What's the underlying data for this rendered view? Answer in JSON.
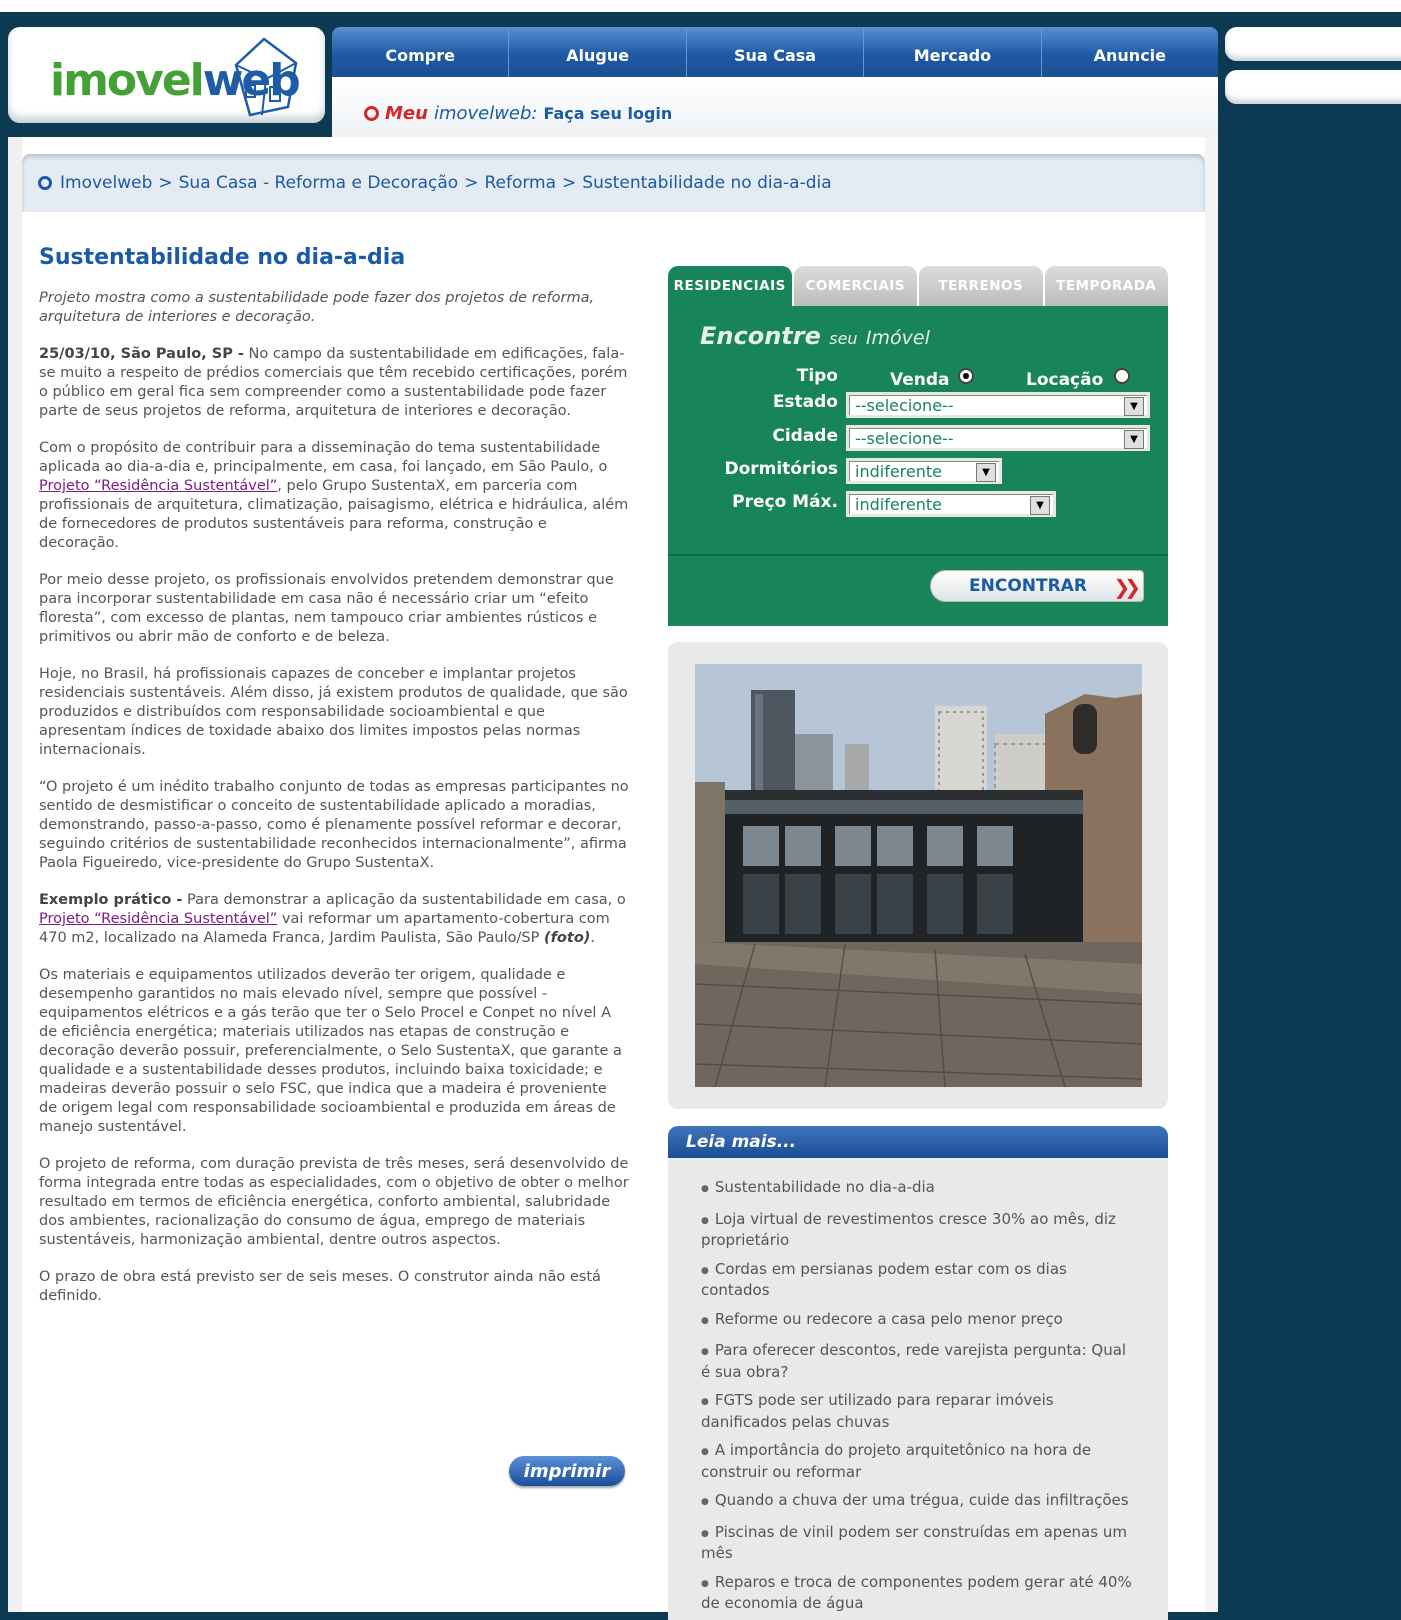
{
  "header": {
    "logo_green": "imovel",
    "logo_blue": "web",
    "nav": [
      "Compre",
      "Alugue",
      "Sua Casa",
      "Mercado",
      "Anuncie"
    ],
    "login": {
      "meu": "Meu",
      "brand": "imovelweb:",
      "action": "Faça seu login"
    }
  },
  "breadcrumb": [
    "Imovelweb",
    "Sua Casa - Reforma e Decoração",
    "Reforma",
    "Sustentabilidade no dia-a-dia"
  ],
  "breadcrumb_sep": ">",
  "article": {
    "title": "Sustentabilidade no dia-a-dia",
    "lead": "Projeto mostra como a sustentabilidade pode fazer dos projetos de reforma, arquitetura de interiores e decoração.",
    "p1_bold": "25/03/10, São Paulo, SP -",
    "p1": " No campo da sustentabilidade em edificações, fala-se muito a respeito de prédios comerciais que têm recebido certificações, porém o público em geral fica sem compreender como a sustentabilidade pode fazer parte de seus projetos de reforma, arquitetura de interiores e decoração.",
    "p2_a": "Com o propósito de contribuir para a disseminação do tema sustentabilidade aplicada ao dia-a-dia e, principalmente, em casa, foi lançado, em São Paulo, o ",
    "p2_link": "Projeto “Residência Sustentável”",
    "p2_b": ", pelo Grupo SustentaX, em parceria com profissionais de arquitetura, climatização, paisagismo, elétrica e hidráulica, além de fornecedores de produtos sustentáveis para reforma, construção e decoração.",
    "p3": "Por meio desse projeto, os profissionais envolvidos pretendem demonstrar que para incorporar sustentabilidade em casa não é necessário criar um “efeito floresta”, com excesso de plantas, nem tampouco criar ambientes rústicos e primitivos ou abrir mão de conforto e de beleza.",
    "p4": "Hoje, no Brasil, há profissionais capazes de conceber e implantar projetos residenciais sustentáveis. Além disso, já existem produtos de qualidade, que são produzidos e distribuídos com responsabilidade socioambiental e que apresentam índices de toxidade abaixo dos limites impostos pelas normas internacionais.",
    "p5": "“O projeto é um inédito trabalho conjunto de todas as empresas participantes no sentido de desmistificar o conceito de sustentabilidade aplicado a moradias, demonstrando, passo-a-passo, como é plenamente possível reformar e decorar, seguindo critérios de sustentabilidade reconhecidos internacionalmente”, afirma Paola Figueiredo, vice-presidente do Grupo SustentaX.",
    "p6_bold": "Exemplo prático -",
    "p6_a": " Para demonstrar a aplicação da sustentabilidade em casa, o ",
    "p6_link": "Projeto “Residência Sustentável”",
    "p6_b": " vai reformar um apartamento-cobertura com 470 m2, localizado na Alameda Franca, Jardim Paulista, São Paulo/SP ",
    "p6_foto": "(foto)",
    "p6_end": ".",
    "p7": "Os materiais e equipamentos utilizados deverão ter origem, qualidade e desempenho garantidos no mais elevado nível, sempre que possível - equipamentos elétricos e a gás terão que ter o Selo Procel e Conpet no nível A de eficiência energética; materiais utilizados nas etapas de construção e decoração deverão possuir, preferencialmente, o Selo SustentaX, que garante a qualidade e a sustentabilidade desses produtos, incluindo baixa toxicidade; e madeiras deverão possuir o selo FSC, que indica que a madeira é proveniente de origem legal com responsabilidade socioambiental e produzida em áreas de manejo sustentável.",
    "p8": "O projeto de reforma, com duração prevista de três meses, será desenvolvido de forma integrada entre todas as especialidades, com o objetivo de obter o melhor resultado em termos de eficiência energética, conforto ambiental, salubridade dos ambientes, racionalização do consumo de água, emprego de materiais sustentáveis, harmonização ambiental, dentre outros aspectos.",
    "p9": "O prazo de obra está previsto ser de seis meses. O construtor ainda não está definido.",
    "print": "imprimir"
  },
  "search": {
    "tabs": [
      "RESIDENCIAIS",
      "COMERCIAIS",
      "TERRENOS",
      "TEMPORADA"
    ],
    "title_a": "Encontre",
    "title_b": "seu",
    "title_c": "Imóvel",
    "tipo_label": "Tipo",
    "venda": "Venda",
    "locacao": "Locação",
    "estado_label": "Estado",
    "estado_value": "--selecione--",
    "cidade_label": "Cidade",
    "cidade_value": "--selecione--",
    "dorm_label": "Dormitórios",
    "dorm_value": "indiferente",
    "preco_label": "Preço Máx.",
    "preco_value": "indiferente",
    "find": "ENCONTRAR"
  },
  "leia_mais": {
    "title": "Leia mais...",
    "items": [
      "Sustentabilidade no dia-a-dia",
      "Loja virtual de revestimentos cresce 30% ao mês, diz proprietário",
      "Cordas em persianas podem estar com os dias contados",
      "Reforme ou redecore a casa pelo menor preço",
      "Para oferecer descontos, rede varejista pergunta: Qual é sua obra?",
      "FGTS pode ser utilizado para reparar imóveis danificados pelas chuvas",
      "A importância do projeto arquitetônico na hora de construir ou reformar",
      "Quando a chuva der uma trégua, cuide das infiltrações",
      "Piscinas de vinil podem ser construídas em apenas um mês",
      "Reparos e troca de componentes podem gerar até 40% de economia de água"
    ]
  }
}
